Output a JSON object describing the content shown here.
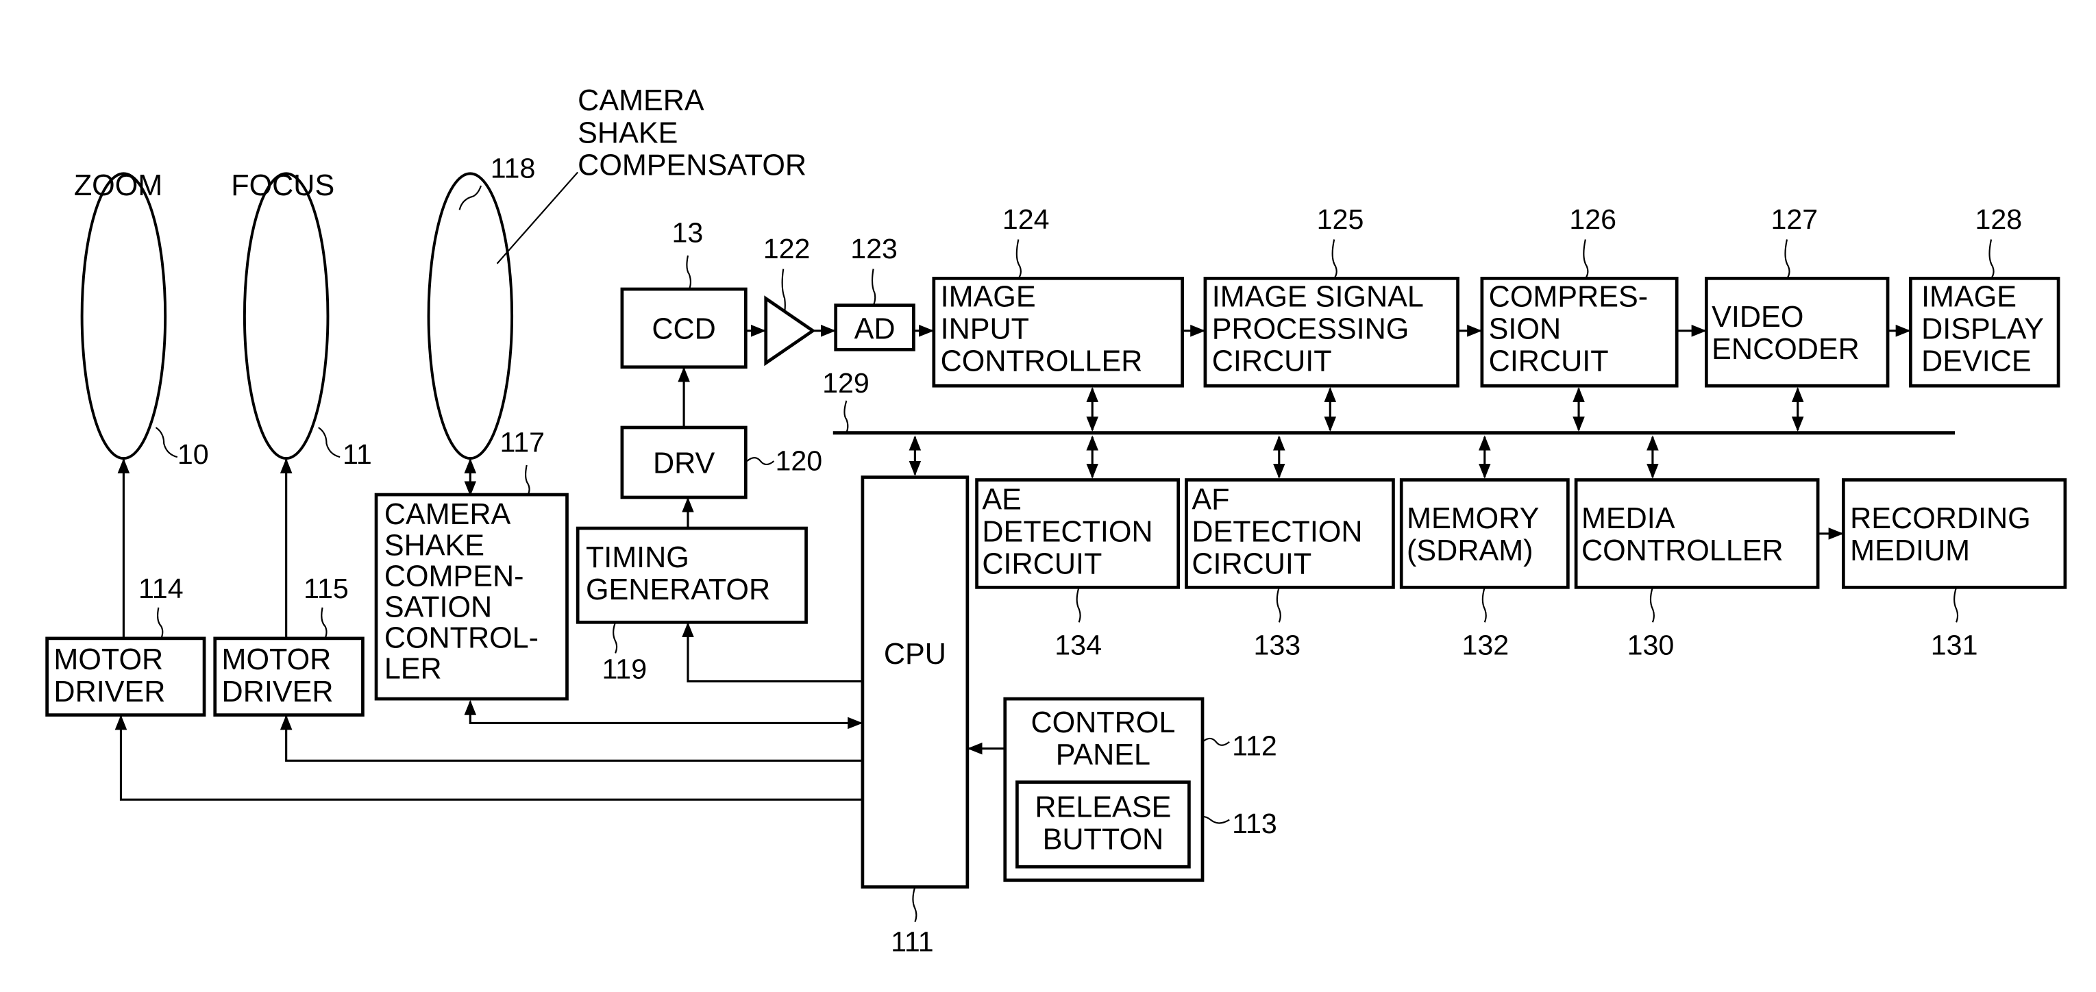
{
  "figure": {
    "lenses": [
      {
        "id": "zoom",
        "title": "ZOOM",
        "ref": "10"
      },
      {
        "id": "focus",
        "title": "FOCUS",
        "ref": "11"
      },
      {
        "id": "shake",
        "title": "",
        "ref": "118"
      }
    ],
    "shake_compensator_label": [
      "CAMERA",
      "SHAKE",
      "COMPENSATOR"
    ],
    "blocks": {
      "motor_driver_1": {
        "lines": [
          "MOTOR",
          "DRIVER"
        ],
        "ref": "114"
      },
      "motor_driver_2": {
        "lines": [
          "MOTOR",
          "DRIVER"
        ],
        "ref": "115"
      },
      "shake_controller": {
        "lines": [
          "CAMERA",
          "SHAKE",
          "COMPEN-",
          "SATION",
          "CONTROL-",
          "LER"
        ],
        "ref": "117"
      },
      "ccd": {
        "lines": [
          "CCD"
        ],
        "ref": "13"
      },
      "amplifier": {
        "lines": [],
        "ref": "122"
      },
      "ad": {
        "lines": [
          "AD"
        ],
        "ref": "123"
      },
      "drv": {
        "lines": [
          "DRV"
        ],
        "ref": "120"
      },
      "timing_generator": {
        "lines": [
          "TIMING",
          "GENERATOR"
        ],
        "ref": "119"
      },
      "image_input_controller": {
        "lines": [
          "IMAGE",
          "INPUT",
          "CONTROLLER"
        ],
        "ref": "124"
      },
      "image_signal_processing": {
        "lines": [
          "IMAGE SIGNAL",
          "PROCESSING",
          "CIRCUIT"
        ],
        "ref": "125"
      },
      "compression": {
        "lines": [
          "COMPRES-",
          "SION",
          "CIRCUIT"
        ],
        "ref": "126"
      },
      "video_encoder": {
        "lines": [
          "VIDEO",
          "ENCODER"
        ],
        "ref": "127"
      },
      "image_display": {
        "lines": [
          "IMAGE",
          "DISPLAY",
          "DEVICE"
        ],
        "ref": "128"
      },
      "cpu": {
        "lines": [
          "CPU"
        ],
        "ref": "111"
      },
      "ae_detection": {
        "lines": [
          "AE",
          "DETECTION",
          "CIRCUIT"
        ],
        "ref": "134"
      },
      "af_detection": {
        "lines": [
          "AF",
          "DETECTION",
          "CIRCUIT"
        ],
        "ref": "133"
      },
      "memory": {
        "lines": [
          "MEMORY",
          "(SDRAM)"
        ],
        "ref": "132"
      },
      "media_controller": {
        "lines": [
          "MEDIA",
          "CONTROLLER"
        ],
        "ref": "130"
      },
      "recording_medium": {
        "lines": [
          "RECORDING",
          "MEDIUM"
        ],
        "ref": "131"
      },
      "control_panel": {
        "lines": [
          "CONTROL",
          "PANEL"
        ],
        "ref": "112"
      },
      "release_button": {
        "lines": [
          "RELEASE",
          "BUTTON"
        ],
        "ref": "113"
      }
    },
    "bus_ref": "129"
  }
}
